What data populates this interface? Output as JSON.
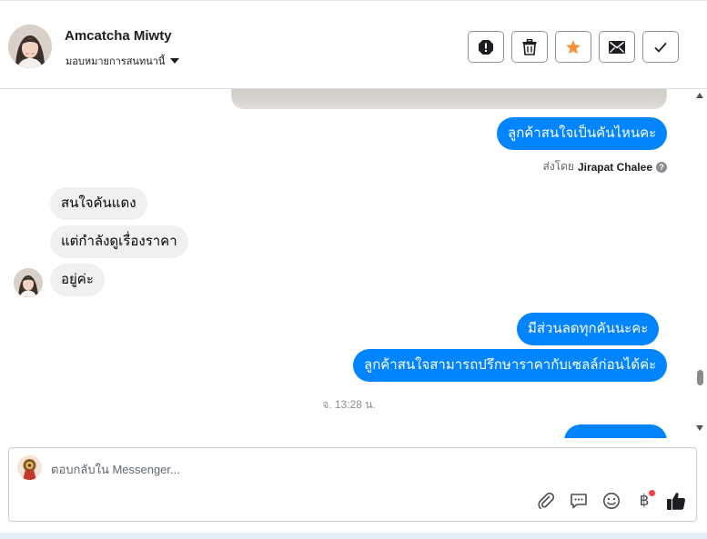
{
  "header": {
    "contact_name": "Amcatcha Miwty",
    "assign_label": "มอบหมายการสนทนานี้",
    "actions": [
      {
        "name": "report-spam-button",
        "icon": "exclamation-icon"
      },
      {
        "name": "delete-button",
        "icon": "trash-icon"
      },
      {
        "name": "star-button",
        "icon": "star-icon"
      },
      {
        "name": "mark-unread-button",
        "icon": "envelope-icon"
      },
      {
        "name": "mark-done-button",
        "icon": "checkmark-icon"
      }
    ]
  },
  "thread": {
    "messages": [
      {
        "direction": "outgoing",
        "text": "ลูกค้าสนใจเป็นคันไหนคะ"
      },
      {
        "direction": "incoming",
        "text": "สนใจคันแดง"
      },
      {
        "direction": "incoming",
        "text": "แต่กำลังดูเรื่องราคา"
      },
      {
        "direction": "incoming",
        "text": "อยู่ค่ะ"
      },
      {
        "direction": "outgoing",
        "text": "มีส่วนลดทุกคันนะคะ"
      },
      {
        "direction": "outgoing",
        "text": "ลูกค้าสนใจสามารถปรึกษาราคากับเซลล์ก่อนได้ค่ะ"
      }
    ],
    "sent_by_prefix": "ส่งโดย",
    "sent_by_name": "Jirapat Chalee",
    "help_mark": "?",
    "timestamp": "จ. 13:28 น."
  },
  "composer": {
    "placeholder": "ตอบกลับใน Messenger...",
    "baht_symbol": "฿",
    "tools": [
      "paperclip-icon",
      "saved-reply-icon",
      "emoji-icon",
      "baht-icon",
      "thumbs-up-icon"
    ]
  },
  "colors": {
    "outgoing_bubble": "#0084ff",
    "incoming_bubble": "#f0f0f0",
    "star": "#f7923b",
    "notification_dot": "#fa3e3e"
  }
}
